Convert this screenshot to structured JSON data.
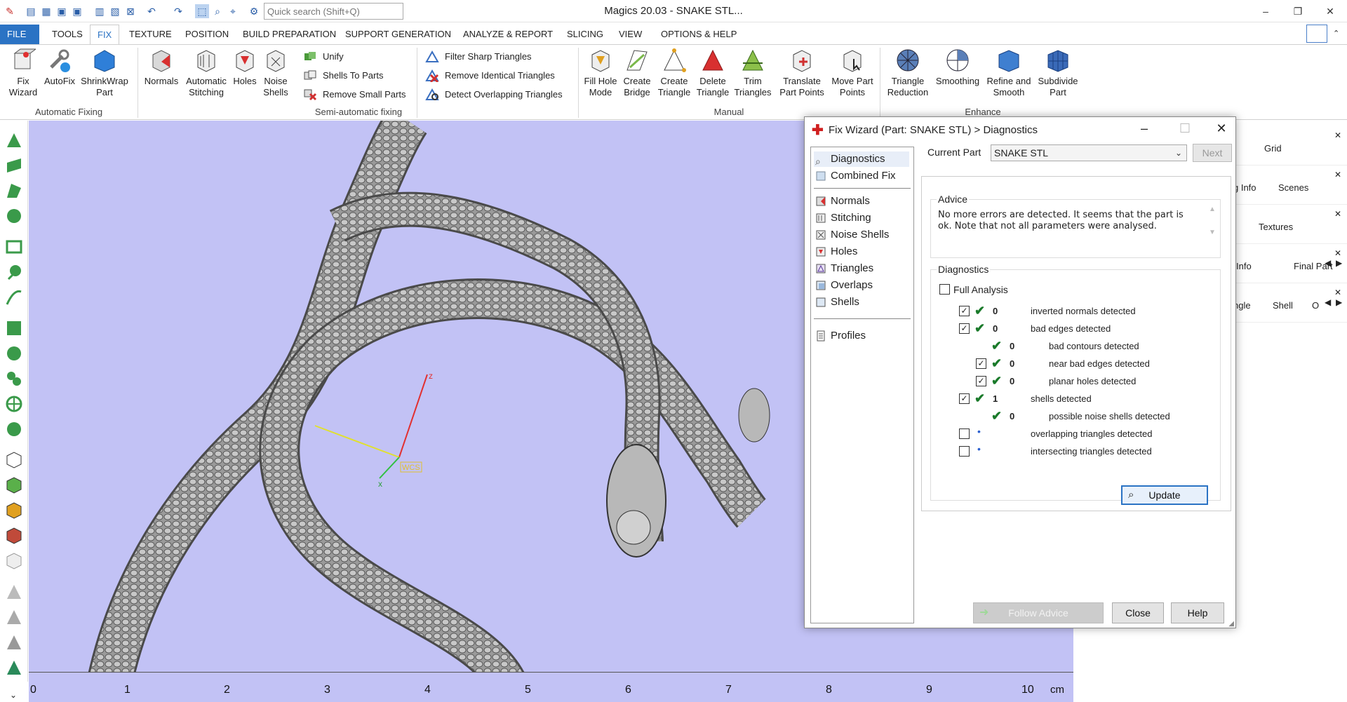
{
  "app": {
    "title": "Magics 20.03 - SNAKE STL...",
    "quick_search_placeholder": "Quick search (Shift+Q)"
  },
  "ribbon_tabs": [
    "FILE",
    "TOOLS",
    "FIX",
    "TEXTURE",
    "POSITION",
    "BUILD PREPARATION",
    "SUPPORT GENERATION",
    "ANALYZE & REPORT",
    "SLICING",
    "VIEW",
    "OPTIONS & HELP"
  ],
  "ribbon": {
    "automatic_fixing": {
      "label": "Automatic Fixing",
      "buttons": [
        "Fix\nWizard",
        "AutoFix",
        "ShrinkWrap\nPart"
      ]
    },
    "semi_automatic": {
      "label": "Semi-automatic fixing",
      "large": [
        "Normals",
        "Automatic\nStitching",
        "Holes",
        "Noise\nShells"
      ],
      "small_col1": [
        "Unify",
        "Shells To Parts",
        "Remove Small Parts"
      ],
      "small_col2": [
        "Filter Sharp Triangles",
        "Remove Identical Triangles",
        "Detect Overlapping Triangles"
      ]
    },
    "manual": {
      "label": "Manual",
      "buttons": [
        "Fill Hole\nMode",
        "Create\nBridge",
        "Create\nTriangle",
        "Delete\nTriangle",
        "Trim\nTriangles",
        "Translate\nPart Points",
        "Move Part\nPoints"
      ]
    },
    "enhance": {
      "label": "Enhance",
      "buttons": [
        "Triangle\nReduction",
        "Smoothing",
        "Refine and\nSmooth",
        "Subdivide\nPart"
      ]
    }
  },
  "viewport": {
    "background": "#c2c2f5",
    "ruler_labels": [
      "0",
      "1",
      "2",
      "3",
      "4",
      "5",
      "6",
      "7",
      "8",
      "9",
      "10"
    ],
    "ruler_unit": "cm",
    "axes": {
      "z": "z",
      "x": "x",
      "wcs": "WCS"
    }
  },
  "right_panels": {
    "grid": "Grid",
    "info": "g Info",
    "scenes": "Scenes",
    "textures": "Textures",
    "info2": "Info",
    "final_part": "Final Part",
    "angle": "ngle",
    "shell": "Shell",
    "o": "O"
  },
  "dialog": {
    "title": "Fix Wizard (Part: SNAKE STL) > Diagnostics",
    "nav": {
      "top": [
        "Diagnostics",
        "Combined Fix"
      ],
      "mid": [
        "Normals",
        "Stitching",
        "Noise Shells",
        "Holes",
        "Triangles",
        "Overlaps",
        "Shells"
      ],
      "bottom": [
        "Profiles"
      ]
    },
    "current_part_label": "Current Part",
    "current_part_value": "SNAKE STL",
    "next_label": "Next",
    "advice_legend": "Advice",
    "advice_text": "No more errors are detected. It seems that the part is ok. Note that not all parameters were analysed.",
    "diagnostics_legend": "Diagnostics",
    "full_analysis_label": "Full Analysis",
    "rows": [
      {
        "count": "0",
        "text": "inverted normals detected"
      },
      {
        "count": "0",
        "text": "bad edges detected"
      },
      {
        "count": "0",
        "text": "bad contours detected"
      },
      {
        "count": "0",
        "text": "near bad edges detected"
      },
      {
        "count": "0",
        "text": "planar holes detected"
      },
      {
        "count": "1",
        "text": "shells detected"
      },
      {
        "count": "0",
        "text": "possible noise shells detected"
      },
      {
        "count": "•",
        "text": "overlapping triangles detected"
      },
      {
        "count": "•",
        "text": "intersecting triangles detected"
      }
    ],
    "update_label": "Update",
    "follow_advice_label": "Follow Advice",
    "close_label": "Close",
    "help_label": "Help"
  }
}
